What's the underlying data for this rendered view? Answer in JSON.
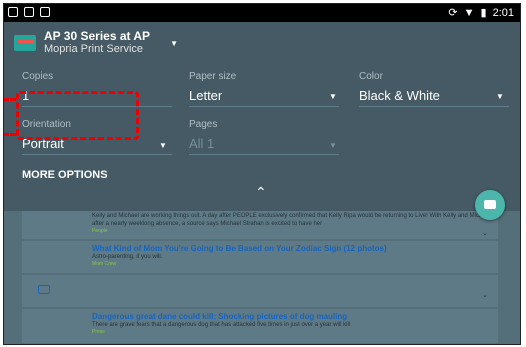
{
  "status_bar": {
    "time": "2:01"
  },
  "printer": {
    "name": "AP 30 Series at AP",
    "service": "Mopria Print Service"
  },
  "settings": {
    "copies": {
      "label": "Copies",
      "value": "1"
    },
    "paper_size": {
      "label": "Paper size",
      "value": "Letter"
    },
    "color": {
      "label": "Color",
      "value": "Black & White"
    },
    "orientation": {
      "label": "Orientation",
      "value": "Portrait"
    },
    "pages": {
      "label": "Pages",
      "value": "All 1"
    }
  },
  "more_options_label": "MORE OPTIONS",
  "preview": {
    "articles": [
      {
        "title": "",
        "desc": "Kelly and Michael are working things out. A day after PEOPLE exclusively confirmed that Kelly Ripa would be returning to Live! With Kelly and Michael after a nearly weeklong absence, a source says Michael Strahan is excited to have her",
        "source": "People"
      },
      {
        "title": "What Kind of Mom You're Going to Be Based on Your Zodiac Sign (12 photos)",
        "desc": "Astro-parenting, if you will.",
        "source": "Mom Crew"
      },
      {
        "title": "Dangerous great dane could kill: Shocking pictures of dog mauling",
        "desc": "There are grave fears that a dangerous dog that has attacked five times in just over a year will kill",
        "source": "Press"
      }
    ]
  },
  "icons": {
    "status_left": [
      "notification-icon",
      "screenshot-icon",
      "download-icon"
    ],
    "status_right": [
      "sync-icon",
      "wifi-icon",
      "battery-icon"
    ],
    "fab": "print-icon"
  },
  "colors": {
    "panel": "#455a64",
    "fab": "#4db6ac",
    "annotation": "#e00000",
    "link": "#1565c0"
  }
}
